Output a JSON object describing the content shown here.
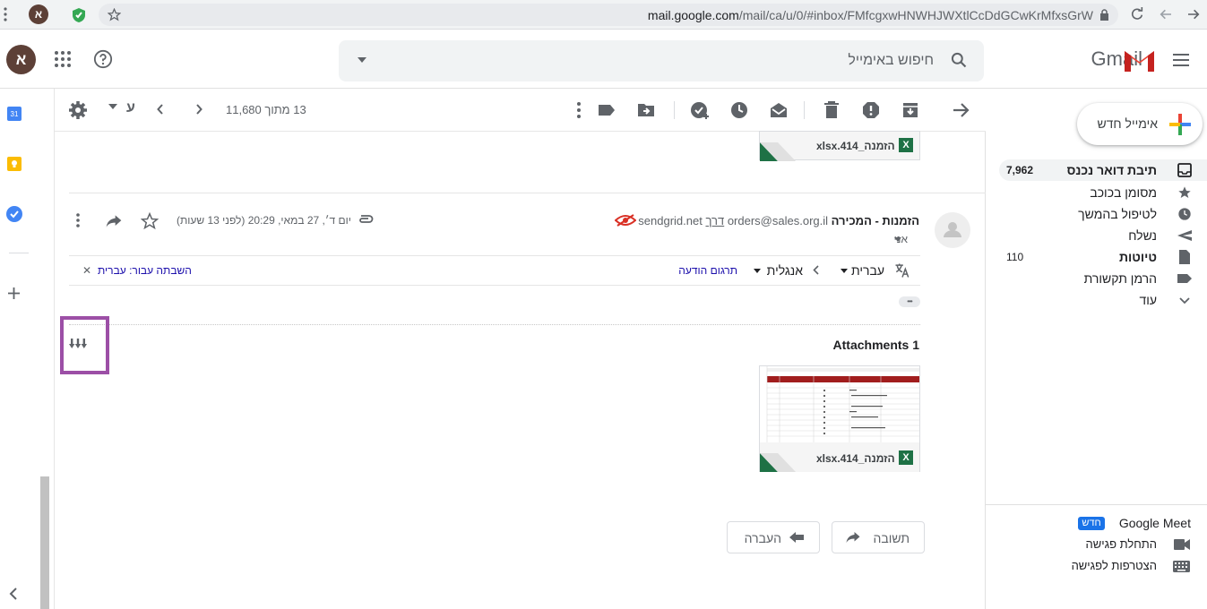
{
  "browser": {
    "url_host": "mail.google.com",
    "url_path": "/mail/ca/u/0/#inbox/FMfcgxwHNWHJWXtlCcDdGCwKrMfxsGrW",
    "profile_letter": "א"
  },
  "header": {
    "search_placeholder": "חיפוש באימייל",
    "logo_text": "Gmail",
    "avatar_letter": "א"
  },
  "toolbar": {
    "count_text": "13 מתוך 11,680",
    "lang_letter": "ע"
  },
  "sidebar": {
    "compose_label": "אימייל חדש",
    "items": [
      {
        "label": "תיבת דואר נכנס",
        "count": "7,962",
        "icon": "inbox-icon"
      },
      {
        "label": "מסומן בכוכב",
        "count": "",
        "icon": "star-icon"
      },
      {
        "label": "לטיפול בהמשך",
        "count": "",
        "icon": "clock-icon"
      },
      {
        "label": "נשלח",
        "count": "",
        "icon": "send-icon"
      },
      {
        "label": "טיוטות",
        "count": "110",
        "icon": "draft-icon"
      },
      {
        "label": "הרמן תקשורת",
        "count": "",
        "icon": "label-icon"
      },
      {
        "label": "עוד",
        "count": "",
        "icon": "chevron-down-icon"
      }
    ],
    "meet": {
      "title": "Google Meet",
      "badge": "חדש",
      "start": "התחלת פגישה",
      "join": "הצטרפות לפגישה"
    }
  },
  "message": {
    "sender_name": "הזמנות - המכירה",
    "sender_email": "orders@sales.org.il",
    "via_word": "דרך",
    "via_domain": "sendgrid.net",
    "to": "אני",
    "date": "יום ד׳, 27 במאי, 20:29 (לפני 13 שעות)",
    "translate": {
      "from_lang": "עברית",
      "to_lang": "אנגלית",
      "translate_link": "תרגום הודעה",
      "disable": "השבתה עבור: עברית"
    },
    "attachments_title": "Attachments 1",
    "attachment_name": "הזמנה_414.xlsx",
    "top_attachment_name": "הזמנה_414.xlsx",
    "excel_letter": "X",
    "reply_label": "תשובה",
    "forward_label": "העברה",
    "ellipsis": "•••"
  },
  "colors": {
    "highlight_box": "#9c4fa6",
    "excel_green": "#1e7145",
    "meet_badge": "#1a73e8"
  }
}
